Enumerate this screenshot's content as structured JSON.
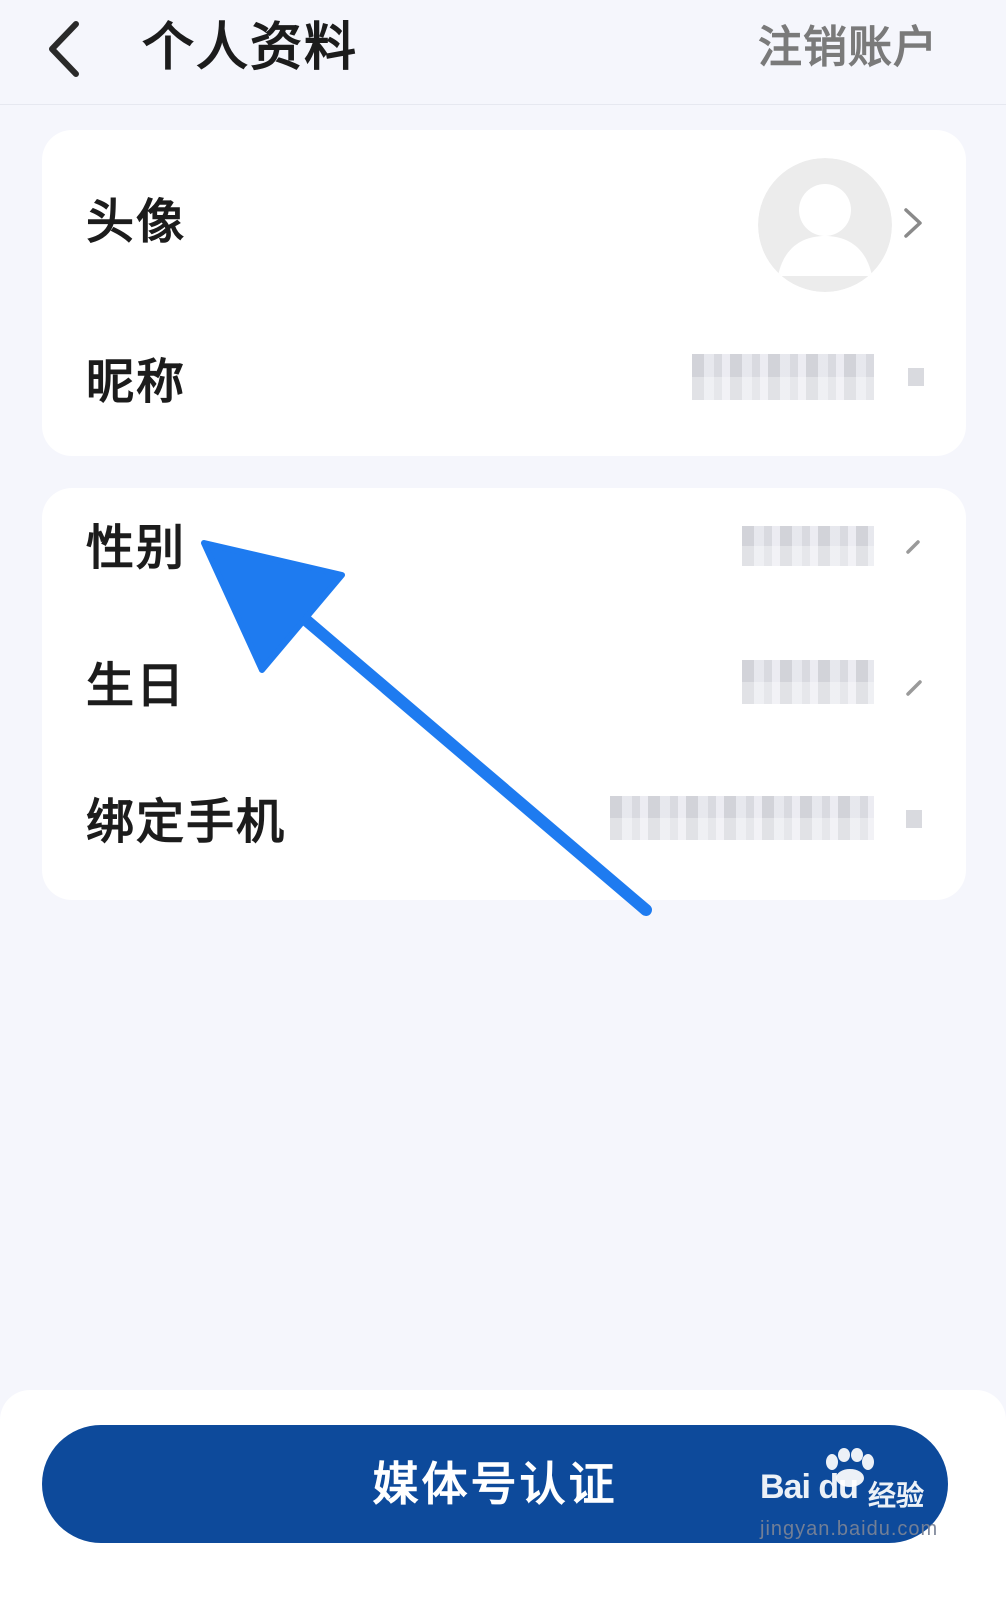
{
  "header": {
    "title": "个人资料",
    "action_label": "注销账户"
  },
  "profile_card": {
    "rows": [
      {
        "label": "头像",
        "icon": "avatar-placeholder-icon"
      },
      {
        "label": "昵称",
        "value": ""
      }
    ]
  },
  "info_card": {
    "rows": [
      {
        "label": "性别",
        "value": ""
      },
      {
        "label": "生日",
        "value": ""
      },
      {
        "label": "绑定手机",
        "value": ""
      }
    ]
  },
  "footer": {
    "button_label": "媒体号认证"
  },
  "watermark": {
    "brand": "Bai du",
    "sub": "经验",
    "url": "jingyan.baidu.com"
  },
  "colors": {
    "background": "#f5f6fc",
    "card": "#ffffff",
    "primary": "#0d4a9b",
    "annotation_arrow": "#1e7bf0",
    "muted_text": "#7a7a7a"
  }
}
